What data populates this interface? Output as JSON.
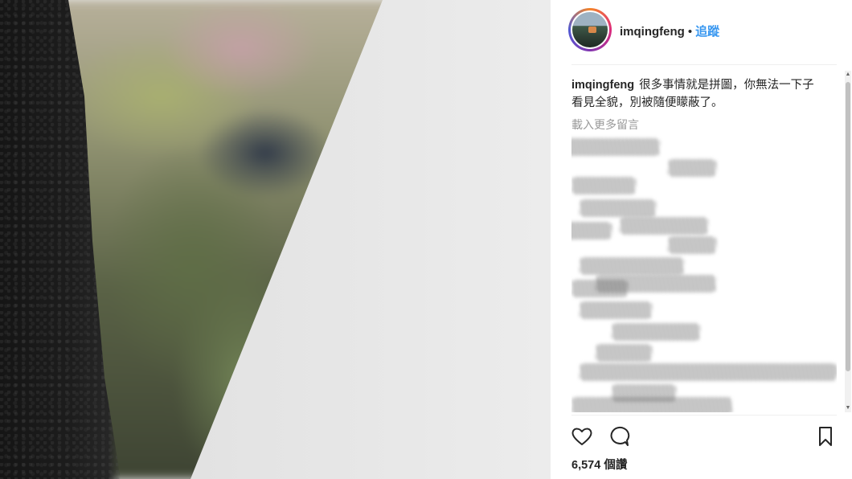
{
  "post": {
    "username": "imqingfeng",
    "separator": "•",
    "follow_label": "追蹤",
    "caption_username": "imqingfeng",
    "caption_text": "很多事情就是拼圖，你無法一下子看見全貌，別被隨便矇蔽了。",
    "load_more_label": "載入更多留言",
    "view_count": "6,574",
    "view_label": "個讚"
  },
  "icons": {
    "like": "heart-icon",
    "comment": "comment-icon",
    "save": "bookmark-icon",
    "avatar": "profile-avatar"
  },
  "colors": {
    "follow": "#3897f0",
    "text": "#262626",
    "muted": "#999999",
    "divider": "#efefef"
  }
}
